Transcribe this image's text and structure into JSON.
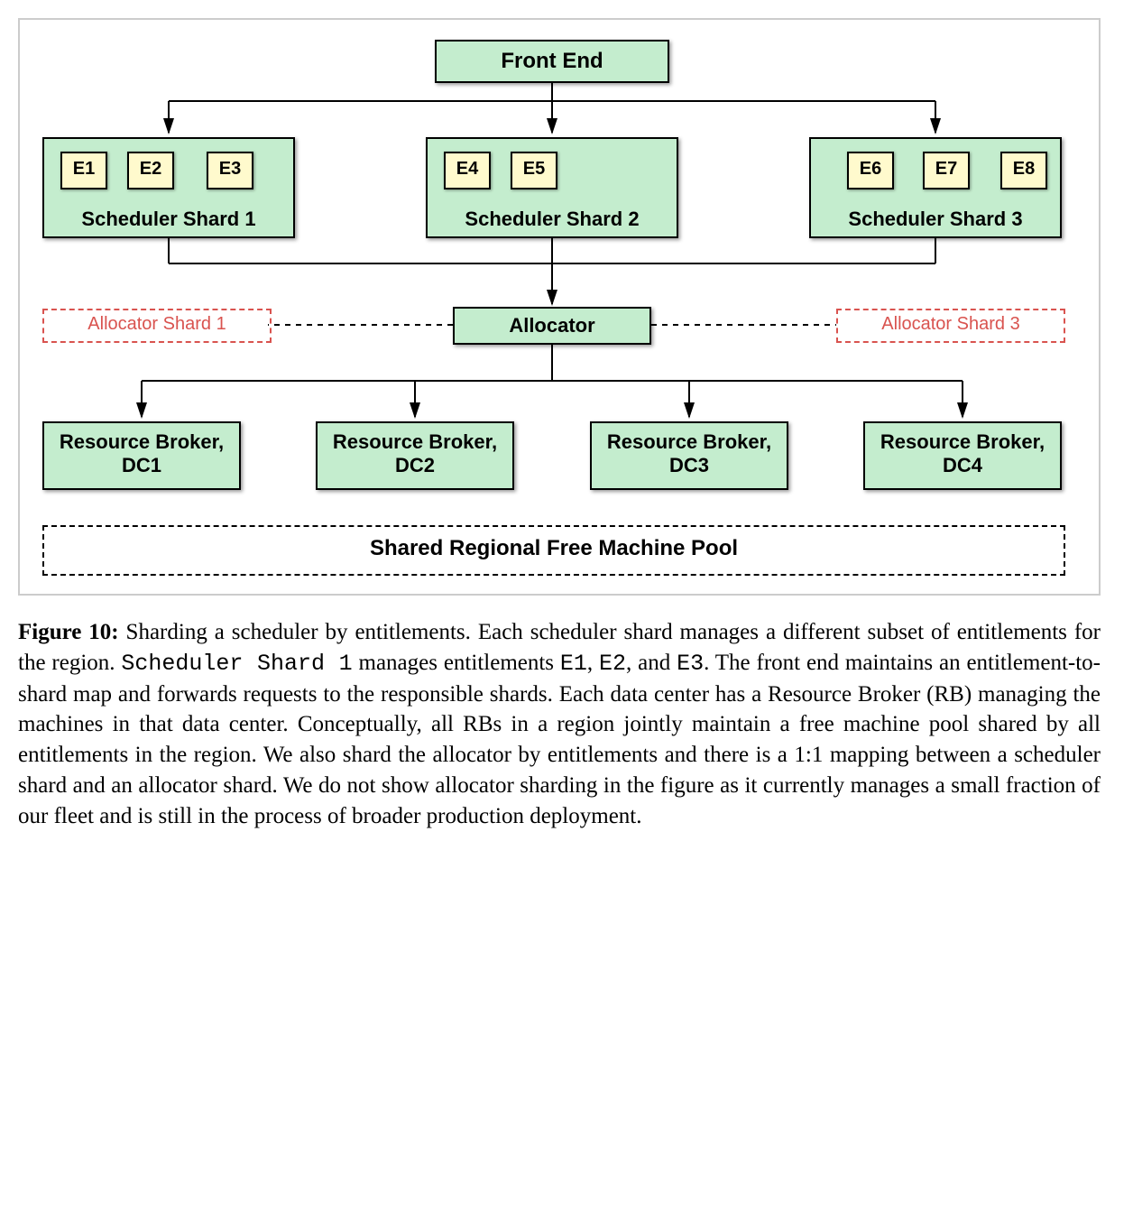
{
  "diagram": {
    "front_end": "Front End",
    "shard1": {
      "label": "Scheduler Shard 1",
      "e1": "E1",
      "e2": "E2",
      "e3": "E3"
    },
    "shard2": {
      "label": "Scheduler Shard 2",
      "e4": "E4",
      "e5": "E5"
    },
    "shard3": {
      "label": "Scheduler Shard 3",
      "e6": "E6",
      "e7": "E7",
      "e8": "E8"
    },
    "allocator": "Allocator",
    "alloc_shard1": "Allocator Shard 1",
    "alloc_shard3": "Allocator Shard 3",
    "rb1": "Resource Broker, DC1",
    "rb2": "Resource Broker, DC2",
    "rb3": "Resource Broker, DC3",
    "rb4": "Resource Broker, DC4",
    "pool": "Shared Regional Free Machine Pool"
  },
  "caption": {
    "figlabel": "Figure 10:",
    "text1": " Sharding a scheduler by entitlements. Each scheduler shard manages a different subset of entitlements for the region. ",
    "mono1": "Scheduler Shard 1",
    "text2": " manages entitlements ",
    "mono2": "E1",
    "text3": ", ",
    "mono3": "E2",
    "text4": ", and ",
    "mono4": "E3",
    "text5": ". The front end maintains an entitlement-to-shard map and forwards requests to the responsible shards. Each data center has a Resource Broker (RB) managing the machines in that data center. Conceptually, all RBs in a region jointly maintain a free machine pool shared by all entitlements in the region. We also shard the allocator by entitlements and there is a 1:1 mapping between a scheduler shard and an allocator shard. We do not show allocator sharding in the figure as it currently manages a small fraction of our fleet and is still in the process of broader production deployment."
  }
}
